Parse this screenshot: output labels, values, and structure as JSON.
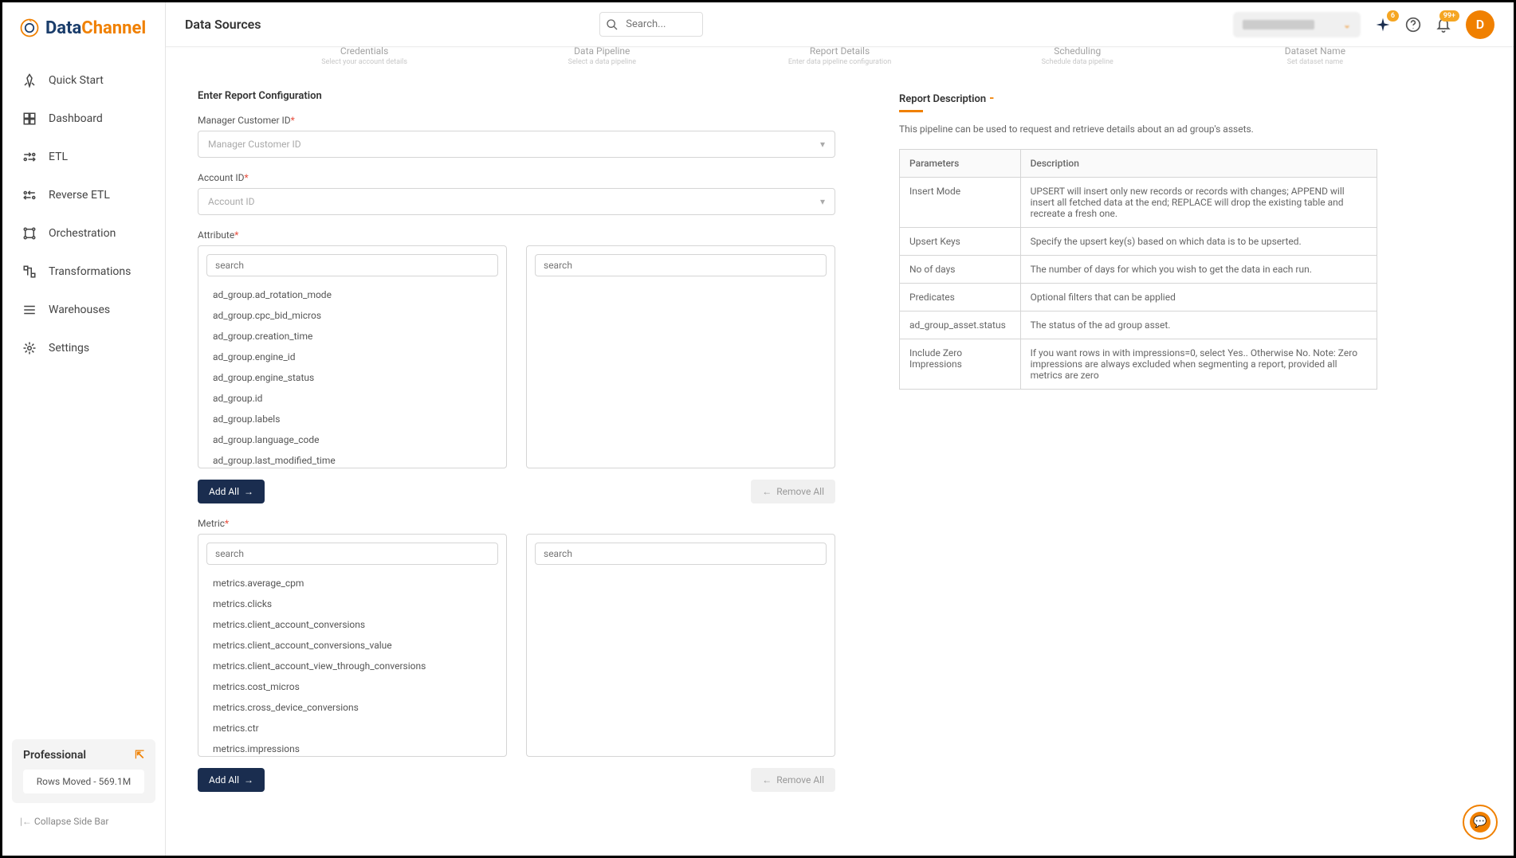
{
  "brand": {
    "part1": "Data",
    "part2": "Channel"
  },
  "header": {
    "title": "Data Sources",
    "search_placeholder": "Search...",
    "sparkle_badge": "6",
    "bell_badge": "99+",
    "avatar_initial": "D"
  },
  "sidebar": {
    "items": [
      {
        "label": "Quick Start"
      },
      {
        "label": "Dashboard"
      },
      {
        "label": "ETL"
      },
      {
        "label": "Reverse ETL"
      },
      {
        "label": "Orchestration"
      },
      {
        "label": "Transformations"
      },
      {
        "label": "Warehouses"
      },
      {
        "label": "Settings"
      }
    ],
    "plan": {
      "name": "Professional",
      "rows": "Rows Moved - 569.1M"
    },
    "collapse": "Collapse Side Bar"
  },
  "wizard": [
    {
      "title": "Credentials",
      "sub": "Select your account details"
    },
    {
      "title": "Data Pipeline",
      "sub": "Select a data pipeline"
    },
    {
      "title": "Report Details",
      "sub": "Enter data pipeline configuration"
    },
    {
      "title": "Scheduling",
      "sub": "Schedule data pipeline"
    },
    {
      "title": "Dataset Name",
      "sub": "Set dataset name"
    }
  ],
  "form": {
    "section_title": "Enter Report Configuration",
    "fields": {
      "manager_customer_id": {
        "label": "Manager Customer ID",
        "placeholder": "Manager Customer ID"
      },
      "account_id": {
        "label": "Account ID",
        "placeholder": "Account ID"
      },
      "attribute": {
        "label": "Attribute"
      },
      "metric": {
        "label": "Metric"
      }
    },
    "search_placeholder": "search",
    "attribute_items": [
      "ad_group.ad_rotation_mode",
      "ad_group.cpc_bid_micros",
      "ad_group.creation_time",
      "ad_group.engine_id",
      "ad_group.engine_status",
      "ad_group.id",
      "ad_group.labels",
      "ad_group.language_code",
      "ad_group.last_modified_time"
    ],
    "metric_items": [
      "metrics.average_cpm",
      "metrics.clicks",
      "metrics.client_account_conversions",
      "metrics.client_account_conversions_value",
      "metrics.client_account_view_through_conversions",
      "metrics.cost_micros",
      "metrics.cross_device_conversions",
      "metrics.ctr",
      "metrics.impressions"
    ],
    "add_all": "Add All",
    "remove_all": "Remove All"
  },
  "description": {
    "title": "Report Description",
    "dash": "-",
    "text": "This pipeline can be used to request and retrieve details about an ad group's assets.",
    "cols": {
      "p": "Parameters",
      "d": "Description"
    },
    "rows": [
      {
        "p": "Insert Mode",
        "d": "UPSERT will insert only new records or records with changes; APPEND will insert all fetched data at the end; REPLACE will drop the existing table and recreate a fresh one."
      },
      {
        "p": "Upsert Keys",
        "d": "Specify the upsert key(s) based on which data is to be upserted."
      },
      {
        "p": "No of days",
        "d": "The number of days for which you wish to get the data in each run."
      },
      {
        "p": "Predicates",
        "d": "Optional filters that can be applied"
      },
      {
        "p": "ad_group_asset.status",
        "d": "The status of the ad group asset."
      },
      {
        "p": "Include Zero Impressions",
        "d": "If you want rows in with impressions=0, select Yes.. Otherwise No. Note: Zero impressions are always excluded when segmenting a report, provided all metrics are zero"
      }
    ]
  }
}
